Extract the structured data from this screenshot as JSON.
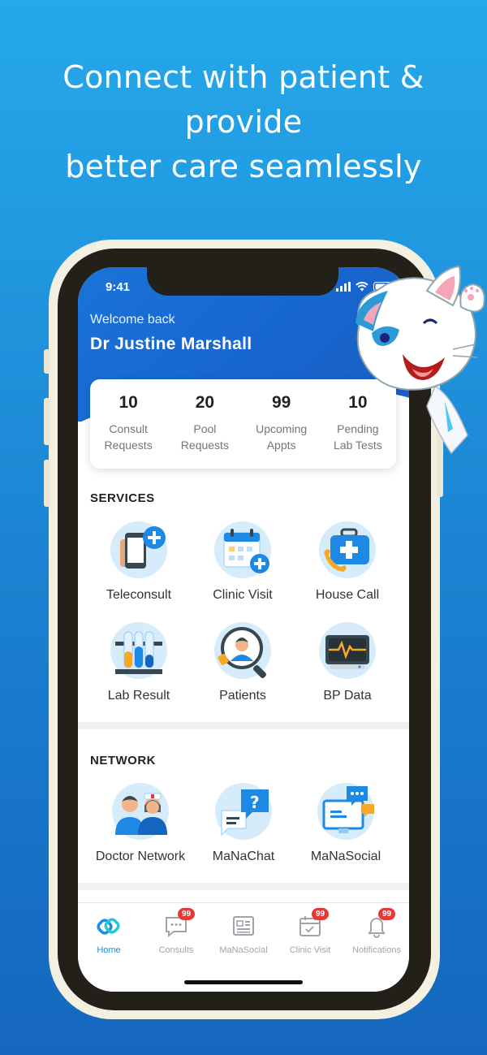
{
  "headline": {
    "line1": "Connect with patient & provide",
    "line2": "better care seamlessly"
  },
  "status_bar": {
    "time": "9:41"
  },
  "header": {
    "welcome": "Welcome back",
    "doctor_name": "Dr Justine Marshall"
  },
  "stats": [
    {
      "value": "10",
      "label_line1": "Consult",
      "label_line2": "Requests"
    },
    {
      "value": "20",
      "label_line1": "Pool",
      "label_line2": "Requests"
    },
    {
      "value": "99",
      "label_line1": "Upcoming",
      "label_line2": "Appts"
    },
    {
      "value": "10",
      "label_line1": "Pending",
      "label_line2": "Lab Tests"
    }
  ],
  "services": {
    "title": "SERVICES",
    "items": [
      {
        "label": "Teleconsult",
        "icon": "teleconsult-icon"
      },
      {
        "label": "Clinic Visit",
        "icon": "calendar-plus-icon"
      },
      {
        "label": "House Call",
        "icon": "medical-kit-icon"
      },
      {
        "label": "Lab Result",
        "icon": "test-tubes-icon"
      },
      {
        "label": "Patients",
        "icon": "patient-search-icon"
      },
      {
        "label": "BP Data",
        "icon": "heart-monitor-icon"
      }
    ]
  },
  "network": {
    "title": "NETWORK",
    "items": [
      {
        "label": "Doctor Network",
        "icon": "doctors-icon"
      },
      {
        "label": "MaNaChat",
        "icon": "chat-question-icon"
      },
      {
        "label": "MaNaSocial",
        "icon": "social-monitor-icon"
      }
    ]
  },
  "tabbar": {
    "tabs": [
      {
        "label": "Home",
        "badge": ""
      },
      {
        "label": "Consults",
        "badge": "99"
      },
      {
        "label": "MaNaSocial",
        "badge": ""
      },
      {
        "label": "Clinic Visit",
        "badge": "99"
      },
      {
        "label": "Notifications",
        "badge": "99"
      }
    ]
  },
  "colors": {
    "brand_blue": "#1a73d8",
    "active_tab": "#1a8ee0",
    "badge_red": "#e53935",
    "icon_circle": "#d6ecfb"
  }
}
